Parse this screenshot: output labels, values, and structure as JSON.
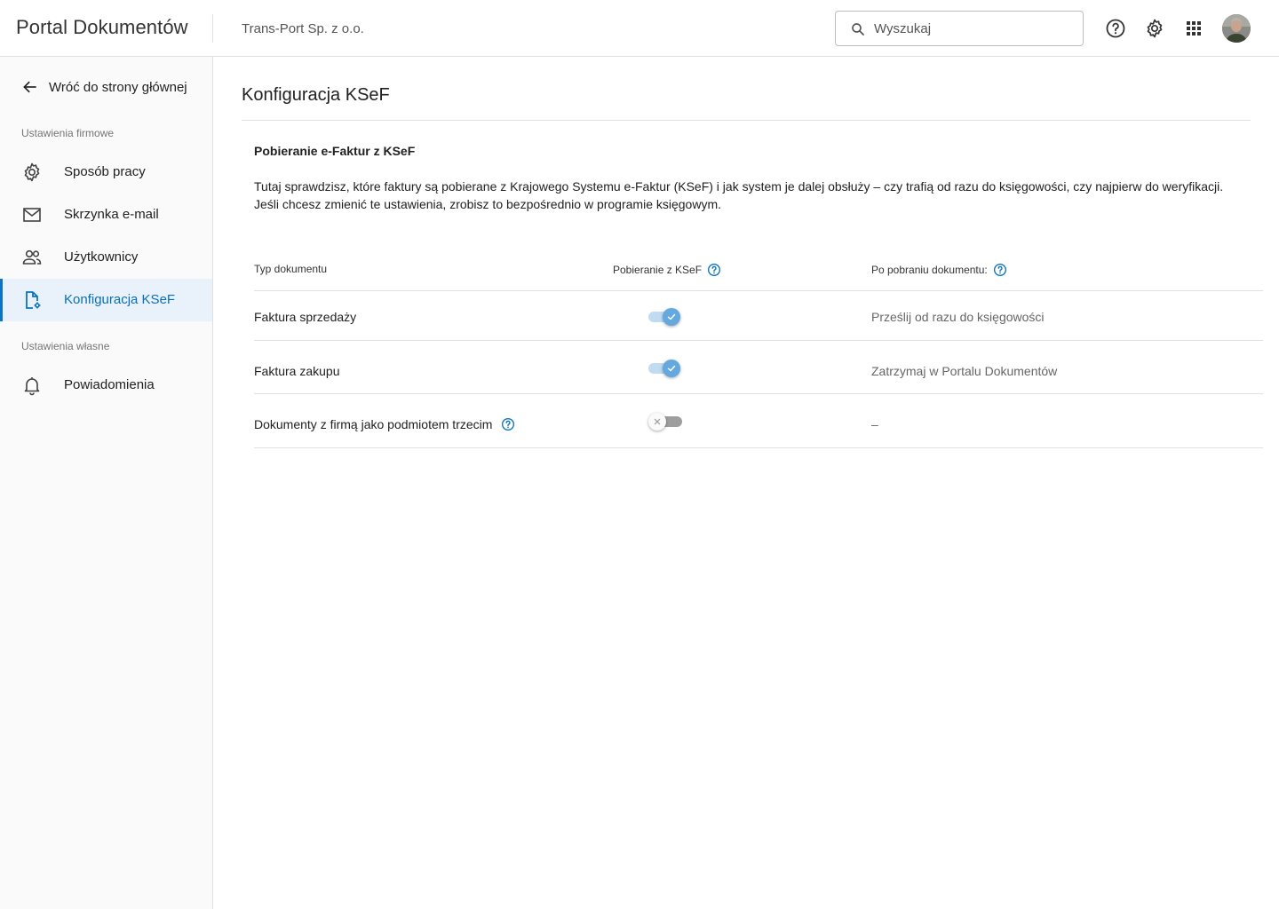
{
  "header": {
    "app_title": "Portal Dokumentów",
    "company": "Trans-Port Sp. z o.o.",
    "search_placeholder": "Wyszukaj",
    "icons": [
      "search-icon",
      "help-icon",
      "settings-icon",
      "apps-grid-icon",
      "user-avatar"
    ]
  },
  "sidebar": {
    "back_label": "Wróć do strony głównej",
    "company_section": "Ustawienia firmowe",
    "own_section": "Ustawienia własne",
    "items": [
      {
        "label": "Sposób pracy",
        "icon": "gear-icon",
        "active": false
      },
      {
        "label": "Skrzynka e-mail",
        "icon": "mail-icon",
        "active": false
      },
      {
        "label": "Użytkownicy",
        "icon": "users-icon",
        "active": false
      },
      {
        "label": "Konfiguracja KSeF",
        "icon": "document-settings-icon",
        "active": true
      },
      {
        "label": "Powiadomienia",
        "icon": "bell-icon",
        "active": false
      }
    ]
  },
  "main": {
    "page_title": "Konfiguracja KSeF",
    "section_title": "Pobieranie e-Faktur z KSeF",
    "description": "Tutaj sprawdzisz, które faktury są  pobierane z Krajowego Systemu e-Faktur (KSeF) i jak system je dalej obsłuży – czy trafią od razu do księgowości, czy najpierw do weryfikacji. Jeśli chcesz zmienić te ustawienia, zrobisz to bezpośrednio w programie księgowym.",
    "table": {
      "headers": [
        "Typ dokumentu",
        "Pobieranie z KSeF",
        "Po pobraniu dokumentu:"
      ],
      "rows": [
        {
          "type": "Faktura sprzedaży",
          "download_enabled": true,
          "after": "Prześlij od razu do księgowości"
        },
        {
          "type": "Faktura zakupu",
          "download_enabled": true,
          "after": "Zatrzymaj w Portalu Dokumentów"
        },
        {
          "type": "Dokumenty z firmą jako podmiotem trzecim",
          "download_enabled": false,
          "after": "–"
        }
      ]
    }
  },
  "colors": {
    "accent": "#0a73c2",
    "active_bg": "#e9f2fb",
    "toggle_on": "#64a8e0",
    "toggle_track_on": "#bfdcf3",
    "toggle_track_off": "#9e9e9e"
  }
}
